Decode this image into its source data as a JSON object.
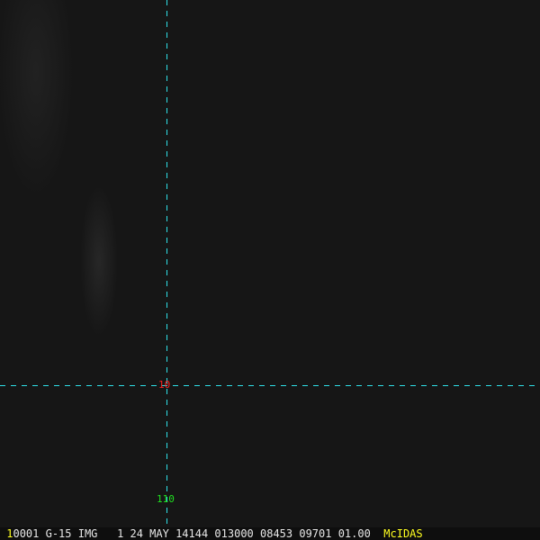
{
  "grid": {
    "lat_label": "10",
    "lon_label": "110",
    "line_color": "#2ee0e8",
    "lat_color": "#ff2020",
    "lon_color": "#20e020"
  },
  "status": {
    "frame": "1",
    "text": "0001 G-15 IMG   1 24 MAY 14144 013000 08453 09701 01.00",
    "brand": "McIDAS"
  }
}
